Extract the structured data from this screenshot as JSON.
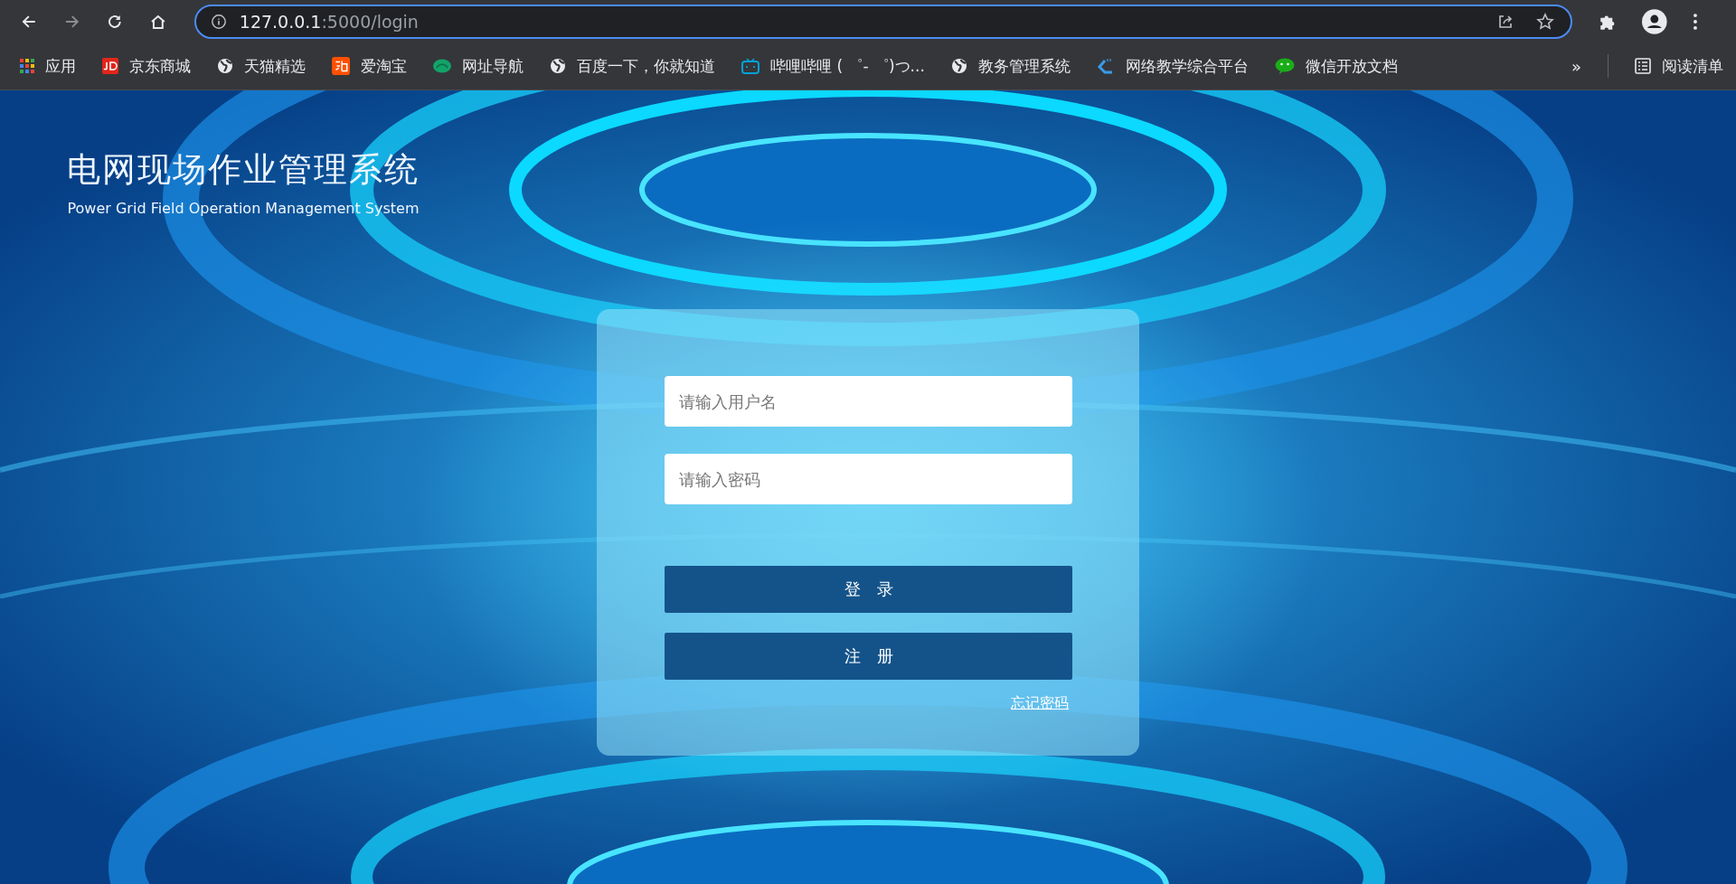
{
  "browser": {
    "address": {
      "host": "127.0.0.1",
      "path": ":5000/login"
    },
    "bookmarks": [
      {
        "kind": "apps",
        "label": "应用"
      },
      {
        "kind": "jd",
        "label": "京东商城"
      },
      {
        "kind": "globe",
        "label": "天猫精选"
      },
      {
        "kind": "tao",
        "label": "爱淘宝"
      },
      {
        "kind": "leaf",
        "label": "网址导航"
      },
      {
        "kind": "globe",
        "label": "百度一下，你就知道"
      },
      {
        "kind": "tv",
        "label": "哔哩哔哩 ( ゜- ゜)つ..."
      },
      {
        "kind": "globe",
        "label": "教务管理系统"
      },
      {
        "kind": "check",
        "label": "网络教学综合平台"
      },
      {
        "kind": "chat",
        "label": "微信开放文档"
      }
    ],
    "more": "»",
    "reading_list": "阅读清单"
  },
  "header": {
    "title": "电网现场作业管理系统",
    "subtitle": "Power Grid Field Operation Management System"
  },
  "login": {
    "username": {
      "placeholder": "请输入用户名"
    },
    "password": {
      "placeholder": "请输入密码"
    },
    "buttons": [
      "登　录",
      "注　册"
    ],
    "forgot": "忘记密码"
  }
}
